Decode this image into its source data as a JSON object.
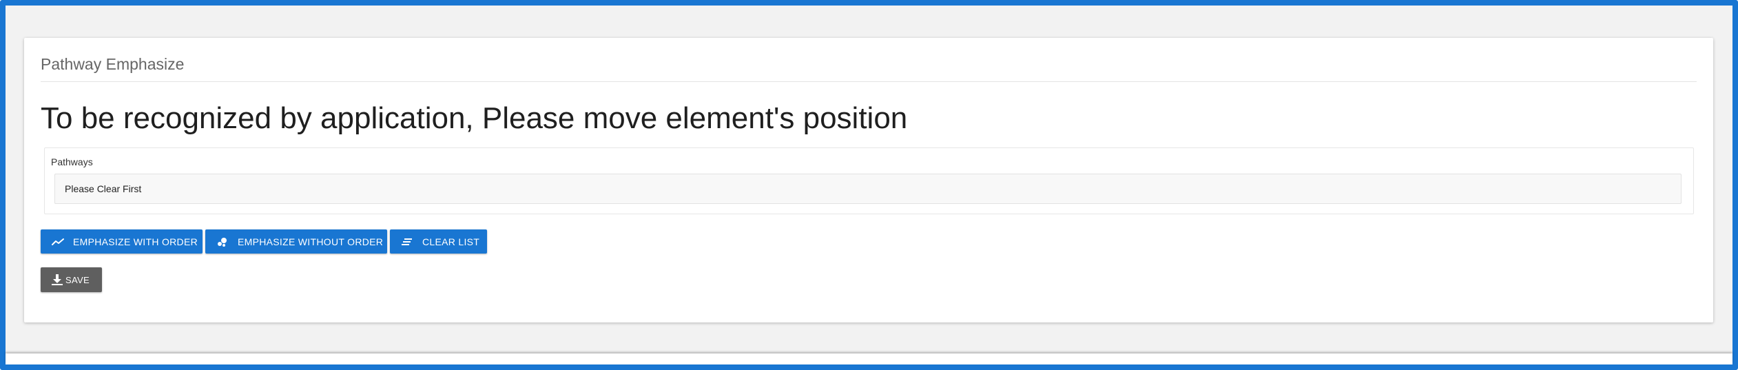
{
  "card": {
    "title": "Pathway Emphasize",
    "headline": "To be recognized by application, Please move element's position"
  },
  "pathways": {
    "label": "Pathways",
    "value": "Please Clear First"
  },
  "buttons": {
    "emphasize_with_order": {
      "label": "EMPHASIZE WITH ORDER",
      "icon": "trending-line-icon"
    },
    "emphasize_without_order": {
      "label": "EMPHASIZE WITHOUT ORDER",
      "icon": "bubbles-icon"
    },
    "clear_list": {
      "label": "CLEAR LIST",
      "icon": "clear-all-icon"
    },
    "save": {
      "label": "SAVE",
      "icon": "download-icon"
    }
  },
  "colors": {
    "frame": "#1976d2",
    "primary_button": "#1976d2",
    "save_button": "#5f5f5f"
  }
}
